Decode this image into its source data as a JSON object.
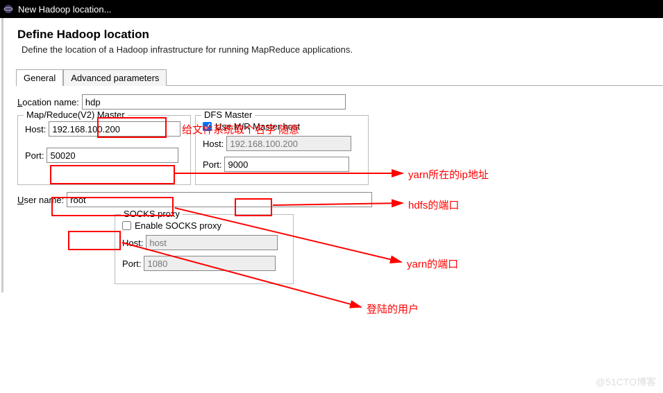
{
  "window": {
    "title": "New Hadoop location..."
  },
  "header": {
    "title": "Define Hadoop location",
    "subtitle": "Define the location of a Hadoop infrastructure for running MapReduce applications."
  },
  "tabs": {
    "general": "General",
    "advanced": "Advanced parameters"
  },
  "form": {
    "location_label_pre": "L",
    "location_label_post": "ocation name:",
    "location_value": "hdp",
    "mr_legend": "Map/Reduce(V2) Master",
    "mr_host_label": "Host:",
    "mr_host_value": "192.168.100.200",
    "mr_port_label": "Port:",
    "mr_port_value": "50020",
    "dfs_legend": "DFS Master",
    "dfs_use_mr_label": "Use M/R Master host",
    "dfs_use_mr_checked": true,
    "dfs_host_label": "Host:",
    "dfs_host_value": "192.168.100.200",
    "dfs_port_label": "Port:",
    "dfs_port_value": "9000",
    "user_label_pre": "U",
    "user_label_post": "ser name:",
    "user_value": "root",
    "socks_legend": "SOCKS proxy",
    "socks_enable_label": "Enable SOCKS proxy",
    "socks_enable_checked": false,
    "socks_host_label": "Host:",
    "socks_host_value": "host",
    "socks_port_label": "Port:",
    "socks_port_value": "1080"
  },
  "annotations": {
    "a1": "给文件系统取个名字 随意",
    "a2": "yarn所在的ip地址",
    "a3": "hdfs的端口",
    "a4": "yarn的端口",
    "a5": "登陆的用户"
  },
  "watermark": "@51CTO博客"
}
